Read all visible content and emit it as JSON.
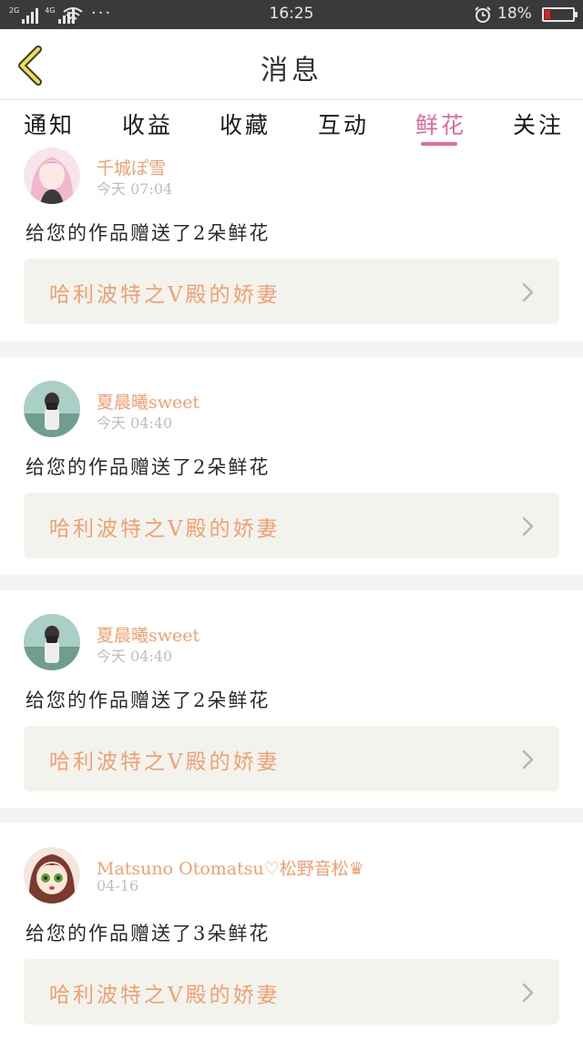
{
  "status_bar": {
    "network_1": "2G",
    "network_2": "4G",
    "dots": "···",
    "time": "16:25",
    "battery": "18%"
  },
  "header": {
    "title": "消息",
    "back_icon": "chevron-left-icon"
  },
  "tabs": [
    {
      "label": "通知",
      "active": false
    },
    {
      "label": "收益",
      "active": false
    },
    {
      "label": "收藏",
      "active": false
    },
    {
      "label": "互动",
      "active": false
    },
    {
      "label": "鲜花",
      "active": true
    },
    {
      "label": "关注",
      "active": false
    }
  ],
  "colors": {
    "accent_pink": "#e06aa0",
    "name_orange": "#f0a070",
    "work_bg": "#f3f3ee",
    "status_bg": "#3a3a3a"
  },
  "messages": [
    {
      "user": "千城ぽ雪",
      "time": "今天 07:04",
      "text": "给您的作品赠送了2朵鲜花",
      "work_title": "哈利波特之V殿的娇妻",
      "avatar": "pink-haired-girl-avatar"
    },
    {
      "user": "夏晨曦sweet",
      "time": "今天 04:40",
      "text": "给您的作品赠送了2朵鲜花",
      "work_title": "哈利波特之V殿的娇妻",
      "avatar": "girl-with-camera-avatar"
    },
    {
      "user": "夏晨曦sweet",
      "time": "今天 04:40",
      "text": "给您的作品赠送了2朵鲜花",
      "work_title": "哈利波特之V殿的娇妻",
      "avatar": "girl-with-camera-avatar"
    },
    {
      "user": "Matsuno  Otomatsu♡松野音松♛",
      "time": "04-16",
      "text": "给您的作品赠送了3朵鲜花",
      "work_title": "哈利波特之V殿的娇妻",
      "avatar": "anime-girl-green-eyes-avatar"
    }
  ]
}
